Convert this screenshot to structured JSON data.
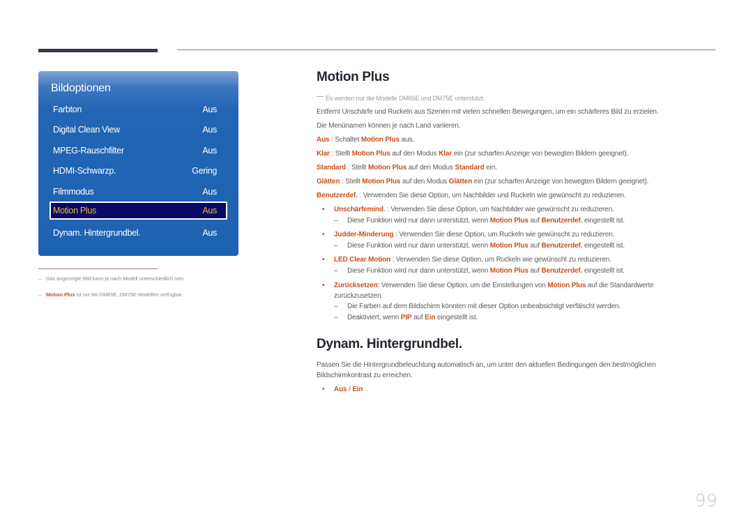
{
  "osd_menu": {
    "title": "Bildoptionen",
    "items": [
      {
        "label": "Farbton",
        "value": "Aus"
      },
      {
        "label": "Digital Clean View",
        "value": "Aus"
      },
      {
        "label": "MPEG-Rauschfilter",
        "value": "Aus"
      },
      {
        "label": "HDMI-Schwarzp.",
        "value": "Gering"
      },
      {
        "label": "Filmmodus",
        "value": "Aus"
      },
      {
        "label": "Motion Plus",
        "value": "Aus",
        "selected": true
      },
      {
        "label": "Dynam. Hintergrundbel.",
        "value": "Aus"
      }
    ]
  },
  "footnotes": [
    {
      "dash": "–",
      "text": "Das angezeigte Bild kann je nach Modell unterschiedlich sein."
    },
    {
      "dash": "–",
      "highlight": "Motion Plus",
      "text": " ist nur bei DM65E, DM75E-Modellen verfügbar."
    }
  ],
  "section_motion_plus": {
    "title": "Motion Plus",
    "note": "Es werden nur die Modelle DM65E und DM75E unterstützt.",
    "intro": "Entfernt Unschärfe und Ruckeln aus Szenen mit vielen schnellen Bewegungen, um ein schärferes Bild zu erzielen.",
    "menu_note": "Die Menünamen können je nach Land variieren.",
    "options": [
      {
        "name": "Aus",
        "t1": " : Schaltet ",
        "h1": "Motion Plus",
        "t2": " aus.",
        "h2": "",
        "t3": ""
      },
      {
        "name": "Klar",
        "t1": " : Stellt ",
        "h1": "Motion Plus",
        "t2": " auf den Modus ",
        "h2": "Klar",
        "t3": " ein (zur scharfen Anzeige von bewegten Bildern geeignet)."
      },
      {
        "name": "Standard",
        "t1": " : Stellt ",
        "h1": "Motion Plus",
        "t2": " auf den Modus ",
        "h2": "Standard",
        "t3": " ein."
      },
      {
        "name": "Glätten",
        "t1": " : Stellt ",
        "h1": "Motion Plus",
        "t2": " auf den Modus ",
        "h2": "Glätten",
        "t3": " ein (zur scharfen Anzeige von bewegten Bildern geeignet)."
      },
      {
        "name": "Benutzerdef.",
        "t1": " : Verwenden Sie diese Option, um Nachbilder und Ruckeln wie gewünscht zu reduzieren.",
        "h1": "",
        "t2": "",
        "h2": "",
        "t3": ""
      }
    ],
    "bullet_glyph": "•",
    "dash_glyph": "–",
    "sub_options": [
      {
        "name": "Unschärfemind.",
        "text": " : Verwenden Sie diese Option, um Nachbilder wie gewünscht zu reduzieren.",
        "note": {
          "t1": "Diese Funktion wird nur dann unterstützt, wenn ",
          "h1": "Motion Plus",
          "t2": " auf ",
          "h2": "Benutzerdef.",
          "t3": " eingestellt ist."
        }
      },
      {
        "name": "Judder-Minderung",
        "text": " : Verwenden Sie diese Option, um Ruckeln wie gewünscht zu reduzieren.",
        "note": {
          "t1": "Diese Funktion wird nur dann unterstützt, wenn ",
          "h1": "Motion Plus",
          "t2": " auf ",
          "h2": "Benutzerdef.",
          "t3": " eingestellt ist."
        }
      },
      {
        "name": "LED Clear Motion",
        "text": " : Verwenden Sie diese Option, um Ruckeln wie gewünscht zu reduzieren.",
        "note": {
          "t1": "Diese Funktion wird nur dann unterstützt, wenn ",
          "h1": "Motion Plus",
          "t2": " auf ",
          "h2": "Benutzerdef.",
          "t3": " eingestellt ist."
        }
      }
    ],
    "reset": {
      "name": "Zurücksetzen",
      "t1": ": Verwenden Sie diese Option, um die Einstellungen von ",
      "h1": "Motion Plus",
      "t2": " auf die Standardwerte",
      "line2": "zurückzusetzen.",
      "note1": "Die Farben auf dem Bildschirm könnten mit dieser Option unbeabsichtigt verfälscht werden.",
      "note2": {
        "t1": "Deaktiviert, wenn ",
        "h1": "PIP",
        "t2": " auf ",
        "h2": "Ein",
        "t3": " eingestellt ist."
      }
    }
  },
  "section_dynam": {
    "title": "Dynam. Hintergrundbel.",
    "line1": "Passen Sie die Hintergrundbeleuchtung automatisch an, um unter den aktuellen Bedingungen den bestmöglichen",
    "line2": "Bildschirmkontrast zu erreichen.",
    "choice_a": "Aus",
    "sep": " / ",
    "choice_b": "Ein"
  },
  "page_number": "99",
  "colors": {
    "highlight": "#c8501e",
    "osd_blue": "#1e62b2",
    "osd_selected_bg": "#0a0a64",
    "osd_selected_text": "#f2b63a",
    "heading": "#2b2230"
  }
}
